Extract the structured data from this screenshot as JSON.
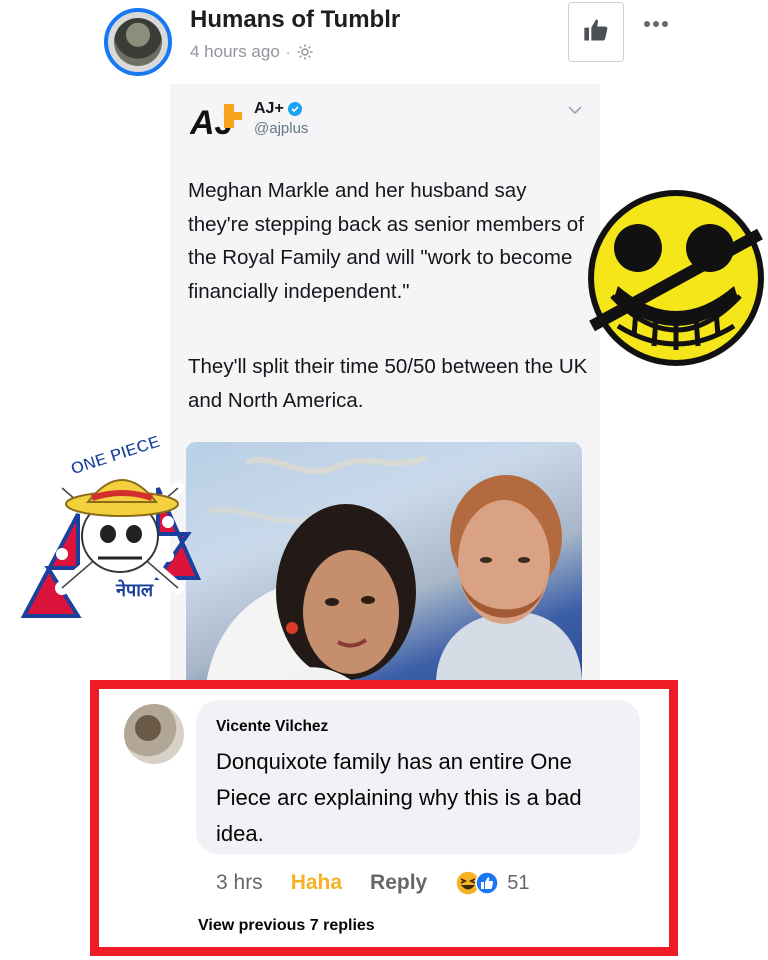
{
  "header": {
    "page_name": "Humans of Tumblr",
    "timestamp": "4 hours ago",
    "separator": "·"
  },
  "tweet": {
    "name": "AJ+",
    "handle": "@ajplus",
    "logo_text": "AJ",
    "paragraphs": [
      "Meghan Markle and her husband say they're stepping back as senior members of the Royal Family and will \"work to become financially independent.\"",
      "They'll split their time 50/50 between the UK and North America."
    ]
  },
  "stickers": {
    "one_piece_logo_text": "ONE PIECE",
    "nepal_text": "नेपाल"
  },
  "comment": {
    "author": "Vicente Vilchez",
    "text": "Donquixote family has an entire One Piece arc explaining why this is a bad idea.",
    "time": "3 hrs",
    "haha_label": "Haha",
    "reply_label": "Reply",
    "reaction_count": "51",
    "view_previous": "View previous 7 replies"
  },
  "colors": {
    "accent_blue": "#1877f2",
    "highlight_red": "#ee1c24",
    "haha_yellow": "#f7b125"
  }
}
